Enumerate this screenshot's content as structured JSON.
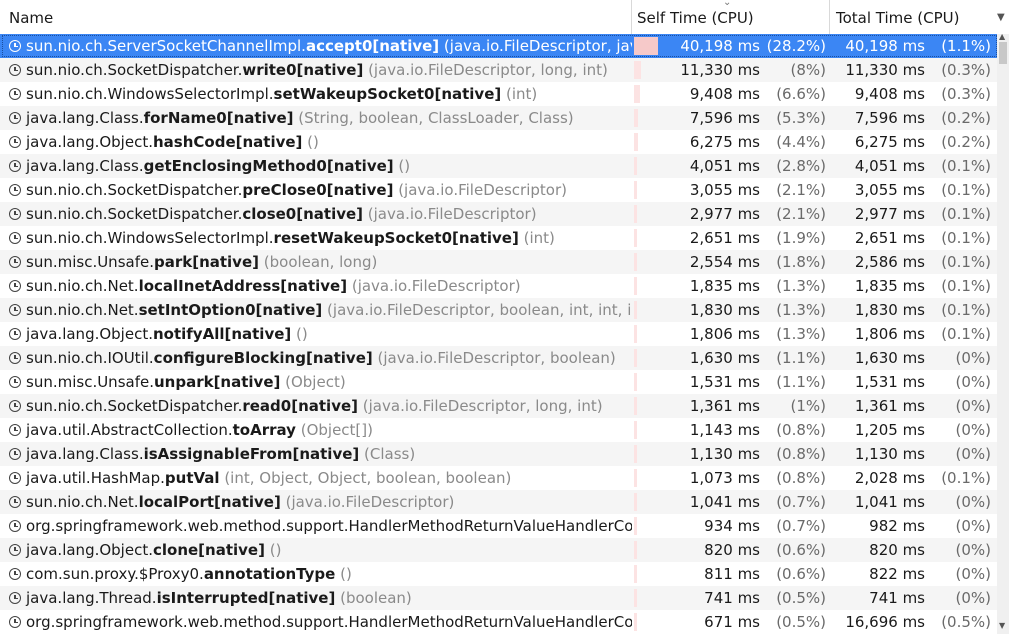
{
  "columns": {
    "name": "Name",
    "self": "Self Time (CPU)",
    "total": "Total Time (CPU)"
  },
  "icons": {
    "sort": "sort-descending-indicator",
    "column_menu": "chevron-down-icon",
    "row_icon": "clock-icon"
  },
  "rows": [
    {
      "cls": "sun.nio.ch.ServerSocketChannelImpl.",
      "method": "accept0[native]",
      "params": " (java.io.FileDescriptor, java.io.",
      "self_ms": "40,198 ms",
      "self_pct": "(28.2%)",
      "self_frac": 0.282,
      "total_ms": "40,198 ms",
      "total_pct": "(1.1%)"
    },
    {
      "cls": "sun.nio.ch.SocketDispatcher.",
      "method": "write0[native]",
      "params": " (java.io.FileDescriptor, long, int)",
      "self_ms": "11,330 ms",
      "self_pct": "(8%)",
      "self_frac": 0.08,
      "total_ms": "11,330 ms",
      "total_pct": "(0.3%)"
    },
    {
      "cls": "sun.nio.ch.WindowsSelectorImpl.",
      "method": "setWakeupSocket0[native]",
      "params": " (int)",
      "self_ms": "9,408 ms",
      "self_pct": "(6.6%)",
      "self_frac": 0.066,
      "total_ms": "9,408 ms",
      "total_pct": "(0.3%)"
    },
    {
      "cls": "java.lang.Class.",
      "method": "forName0[native]",
      "params": " (String, boolean, ClassLoader, Class)",
      "self_ms": "7,596 ms",
      "self_pct": "(5.3%)",
      "self_frac": 0.053,
      "total_ms": "7,596 ms",
      "total_pct": "(0.2%)"
    },
    {
      "cls": "java.lang.Object.",
      "method": "hashCode[native]",
      "params": " ()",
      "self_ms": "6,275 ms",
      "self_pct": "(4.4%)",
      "self_frac": 0.044,
      "total_ms": "6,275 ms",
      "total_pct": "(0.2%)"
    },
    {
      "cls": "java.lang.Class.",
      "method": "getEnclosingMethod0[native]",
      "params": " ()",
      "self_ms": "4,051 ms",
      "self_pct": "(2.8%)",
      "self_frac": 0.028,
      "total_ms": "4,051 ms",
      "total_pct": "(0.1%)"
    },
    {
      "cls": "sun.nio.ch.SocketDispatcher.",
      "method": "preClose0[native]",
      "params": " (java.io.FileDescriptor)",
      "self_ms": "3,055 ms",
      "self_pct": "(2.1%)",
      "self_frac": 0.021,
      "total_ms": "3,055 ms",
      "total_pct": "(0.1%)"
    },
    {
      "cls": "sun.nio.ch.SocketDispatcher.",
      "method": "close0[native]",
      "params": " (java.io.FileDescriptor)",
      "self_ms": "2,977 ms",
      "self_pct": "(2.1%)",
      "self_frac": 0.021,
      "total_ms": "2,977 ms",
      "total_pct": "(0.1%)"
    },
    {
      "cls": "sun.nio.ch.WindowsSelectorImpl.",
      "method": "resetWakeupSocket0[native]",
      "params": " (int)",
      "self_ms": "2,651 ms",
      "self_pct": "(1.9%)",
      "self_frac": 0.019,
      "total_ms": "2,651 ms",
      "total_pct": "(0.1%)"
    },
    {
      "cls": "sun.misc.Unsafe.",
      "method": "park[native]",
      "params": " (boolean, long)",
      "self_ms": "2,554 ms",
      "self_pct": "(1.8%)",
      "self_frac": 0.018,
      "total_ms": "2,586 ms",
      "total_pct": "(0.1%)"
    },
    {
      "cls": "sun.nio.ch.Net.",
      "method": "localInetAddress[native]",
      "params": " (java.io.FileDescriptor)",
      "self_ms": "1,835 ms",
      "self_pct": "(1.3%)",
      "self_frac": 0.013,
      "total_ms": "1,835 ms",
      "total_pct": "(0.1%)"
    },
    {
      "cls": "sun.nio.ch.Net.",
      "method": "setIntOption0[native]",
      "params": " (java.io.FileDescriptor, boolean, int, int, int,",
      "self_ms": "1,830 ms",
      "self_pct": "(1.3%)",
      "self_frac": 0.013,
      "total_ms": "1,830 ms",
      "total_pct": "(0.1%)"
    },
    {
      "cls": "java.lang.Object.",
      "method": "notifyAll[native]",
      "params": " ()",
      "self_ms": "1,806 ms",
      "self_pct": "(1.3%)",
      "self_frac": 0.013,
      "total_ms": "1,806 ms",
      "total_pct": "(0.1%)"
    },
    {
      "cls": "sun.nio.ch.IOUtil.",
      "method": "configureBlocking[native]",
      "params": " (java.io.FileDescriptor, boolean)",
      "self_ms": "1,630 ms",
      "self_pct": "(1.1%)",
      "self_frac": 0.011,
      "total_ms": "1,630 ms",
      "total_pct": "(0%)"
    },
    {
      "cls": "sun.misc.Unsafe.",
      "method": "unpark[native]",
      "params": " (Object)",
      "self_ms": "1,531 ms",
      "self_pct": "(1.1%)",
      "self_frac": 0.011,
      "total_ms": "1,531 ms",
      "total_pct": "(0%)"
    },
    {
      "cls": "sun.nio.ch.SocketDispatcher.",
      "method": "read0[native]",
      "params": " (java.io.FileDescriptor, long, int)",
      "self_ms": "1,361 ms",
      "self_pct": "(1%)",
      "self_frac": 0.01,
      "total_ms": "1,361 ms",
      "total_pct": "(0%)"
    },
    {
      "cls": "java.util.AbstractCollection.",
      "method": "toArray",
      "params": " (Object[])",
      "self_ms": "1,143 ms",
      "self_pct": "(0.8%)",
      "self_frac": 0.008,
      "total_ms": "1,205 ms",
      "total_pct": "(0%)"
    },
    {
      "cls": "java.lang.Class.",
      "method": "isAssignableFrom[native]",
      "params": " (Class)",
      "self_ms": "1,130 ms",
      "self_pct": "(0.8%)",
      "self_frac": 0.008,
      "total_ms": "1,130 ms",
      "total_pct": "(0%)"
    },
    {
      "cls": "java.util.HashMap.",
      "method": "putVal",
      "params": " (int, Object, Object, boolean, boolean)",
      "self_ms": "1,073 ms",
      "self_pct": "(0.8%)",
      "self_frac": 0.008,
      "total_ms": "2,028 ms",
      "total_pct": "(0.1%)"
    },
    {
      "cls": "sun.nio.ch.Net.",
      "method": "localPort[native]",
      "params": " (java.io.FileDescriptor)",
      "self_ms": "1,041 ms",
      "self_pct": "(0.7%)",
      "self_frac": 0.007,
      "total_ms": "1,041 ms",
      "total_pct": "(0%)"
    },
    {
      "cls": "org.springframework.web.method.support.HandlerMethodReturnValueHandlerCompo",
      "method": "",
      "params": "",
      "self_ms": "934 ms",
      "self_pct": "(0.7%)",
      "self_frac": 0.007,
      "total_ms": "982 ms",
      "total_pct": "(0%)"
    },
    {
      "cls": "java.lang.Object.",
      "method": "clone[native]",
      "params": " ()",
      "self_ms": "820 ms",
      "self_pct": "(0.6%)",
      "self_frac": 0.006,
      "total_ms": "820 ms",
      "total_pct": "(0%)"
    },
    {
      "cls": "com.sun.proxy.$Proxy0.",
      "method": "annotationType",
      "params": " ()",
      "self_ms": "811 ms",
      "self_pct": "(0.6%)",
      "self_frac": 0.006,
      "total_ms": "822 ms",
      "total_pct": "(0%)"
    },
    {
      "cls": "java.lang.Thread.",
      "method": "isInterrupted[native]",
      "params": " (boolean)",
      "self_ms": "741 ms",
      "self_pct": "(0.5%)",
      "self_frac": 0.005,
      "total_ms": "741 ms",
      "total_pct": "(0%)"
    },
    {
      "cls": "org.springframework.web.method.support.HandlerMethodReturnValueHandlerCompo",
      "method": "",
      "params": "",
      "self_ms": "671 ms",
      "self_pct": "(0.5%)",
      "self_frac": 0.005,
      "total_ms": "16,696 ms",
      "total_pct": "(0.5%)"
    }
  ],
  "selected_row": 0
}
